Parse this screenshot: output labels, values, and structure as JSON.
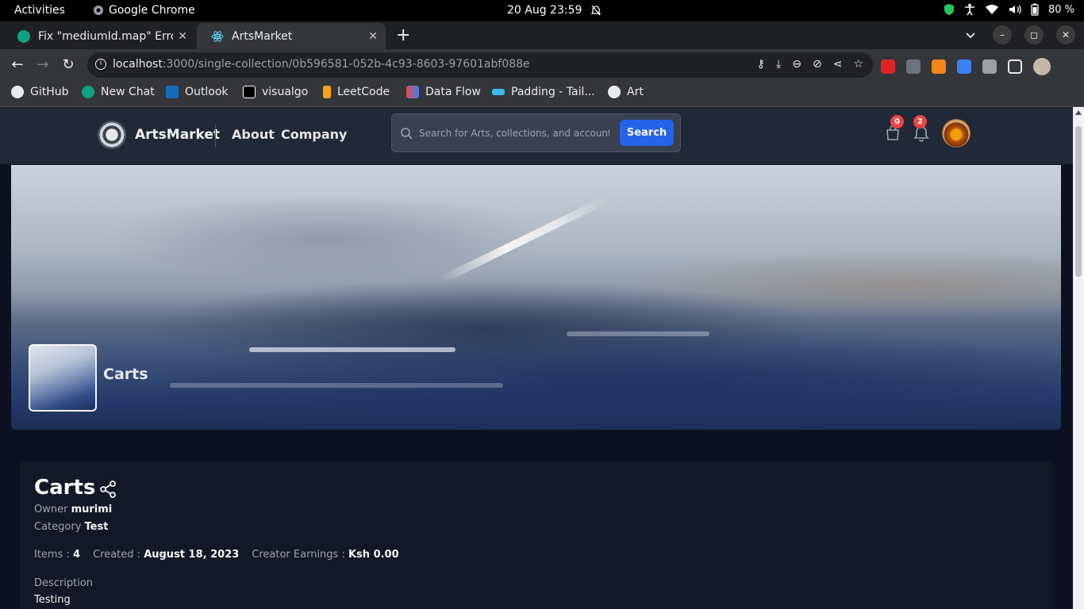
{
  "system": {
    "activities": "Activities",
    "app_name": "Google Chrome",
    "datetime": "20 Aug  23:59",
    "battery": "80 %"
  },
  "tabs": [
    {
      "title": "Fix \"mediumId.map\" Error"
    },
    {
      "title": "ArtsMarket"
    }
  ],
  "address": {
    "host": "localhost",
    "path": ":3000/single-collection/0b596581-052b-4c93-8603-97601abf088e"
  },
  "bookmarks": [
    {
      "label": "GitHub"
    },
    {
      "label": "New Chat"
    },
    {
      "label": "Outlook"
    },
    {
      "label": "visualgo"
    },
    {
      "label": "LeetCode"
    },
    {
      "label": "Data Flow"
    },
    {
      "label": "Padding - Tail..."
    },
    {
      "label": "Art"
    }
  ],
  "site": {
    "brand": "ArtsMarket",
    "nav": [
      {
        "label": "About"
      },
      {
        "label": "Company"
      }
    ],
    "search_placeholder": "Search for Arts, collections, and accounts",
    "search_button": "Search",
    "cart_count": "0",
    "notification_count": "2"
  },
  "banner": {
    "collection_name": "Carts"
  },
  "collection": {
    "title": "Carts",
    "owner_label": "Owner",
    "owner": "murimi",
    "category_label": "Category",
    "category": "Test",
    "items_label": "Items :",
    "items": "4",
    "created_label": "Created :",
    "created": "August 18, 2023",
    "earnings_label": "Creator Earnings :",
    "earnings": "Ksh 0.00",
    "description_label": "Description",
    "description": "Testing"
  },
  "colors": {
    "accent": "#2563eb",
    "badge": "#ef4444",
    "nav_bg": "#1f2937",
    "page_bg": "#0b1120"
  }
}
